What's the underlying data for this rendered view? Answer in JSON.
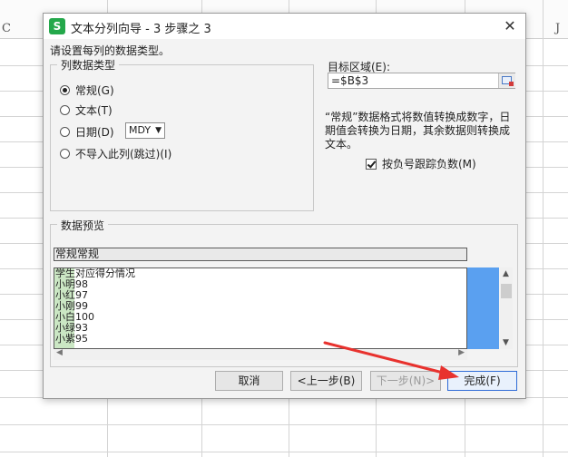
{
  "sheet": {
    "columns": [
      "C",
      "J"
    ]
  },
  "dialog": {
    "title": "文本分列向导 - 3 步骤之 3",
    "app_icon_letter": "S",
    "close_glyph": "✕",
    "instruction": "请设置每列的数据类型。",
    "column_format": {
      "legend": "列数据类型",
      "options": [
        {
          "label": "常规(G)",
          "checked": true
        },
        {
          "label": "文本(T)",
          "checked": false
        },
        {
          "label": "日期(D)",
          "checked": false
        },
        {
          "label": "不导入此列(跳过)(I)",
          "checked": false
        }
      ],
      "date_format": "MDY"
    },
    "target": {
      "label": "目标区域(E):",
      "value": "=$B$3"
    },
    "description": "“常规”数据格式将数值转换成数字，日期值会转换为日期，其余数据则转换成文本。",
    "negative_checkbox": {
      "label": "按负号跟踪负数(M)",
      "checked": true
    },
    "preview": {
      "legend": "数据预览",
      "header": "常规常规",
      "lines": [
        "学生对应得分情况",
        "小明98",
        "小红97",
        "小刚99",
        "小白100",
        "小绿93",
        "小紫95"
      ]
    },
    "buttons": {
      "cancel": "取消",
      "back": "<上一步(B)",
      "next": "下一步(N)>",
      "finish": "完成(F)"
    }
  },
  "colors": {
    "accent_blue": "#5aa0f0",
    "icon_green": "#24a84b",
    "arrow_red": "#e8322e",
    "preview_col_green": "#cbe7c4"
  }
}
